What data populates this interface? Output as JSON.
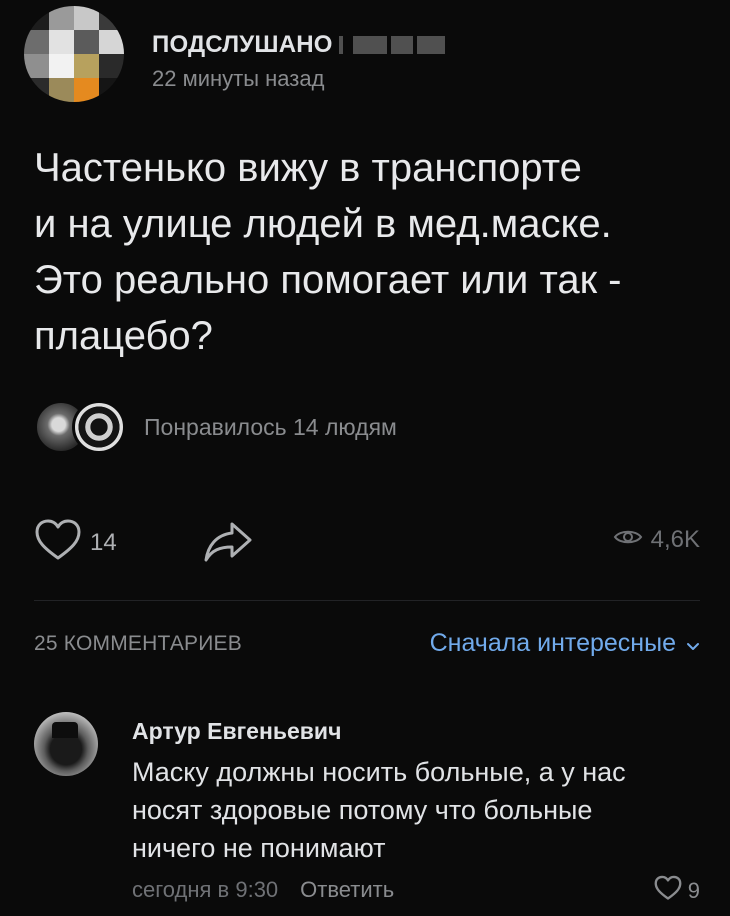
{
  "post": {
    "group_name": "ПОДСЛУШАНО",
    "time": "22 минуты назад",
    "text_lines": [
      "Частенько вижу в транспорте",
      "и на улице людей в мед.маске.",
      "Это реально помогает или так -",
      "плацебо?"
    ],
    "liked_by_text": "Понравилось 14 людям",
    "likes_count": "14",
    "views_count": "4,6K"
  },
  "comments_section": {
    "count_label": "25 КОММЕНТАРИЕВ",
    "sort_label": "Сначала интересные"
  },
  "comment": {
    "author": "Артур Евгеньевич",
    "text_lines": [
      "Маску должны носить больные, а у нас",
      "носят здоровые потому что больные",
      "ничего не понимают"
    ],
    "time": "сегодня в 9:30",
    "reply_label": "Ответить",
    "likes_count": "9"
  },
  "icons": {
    "like": "heart-icon",
    "share": "share-arrow-icon",
    "views": "eye-icon",
    "sort": "chevron-down-icon"
  },
  "colors": {
    "background": "#0a0a0a",
    "accent_link": "#71aaeb",
    "secondary_text": "#8a8c8f"
  }
}
